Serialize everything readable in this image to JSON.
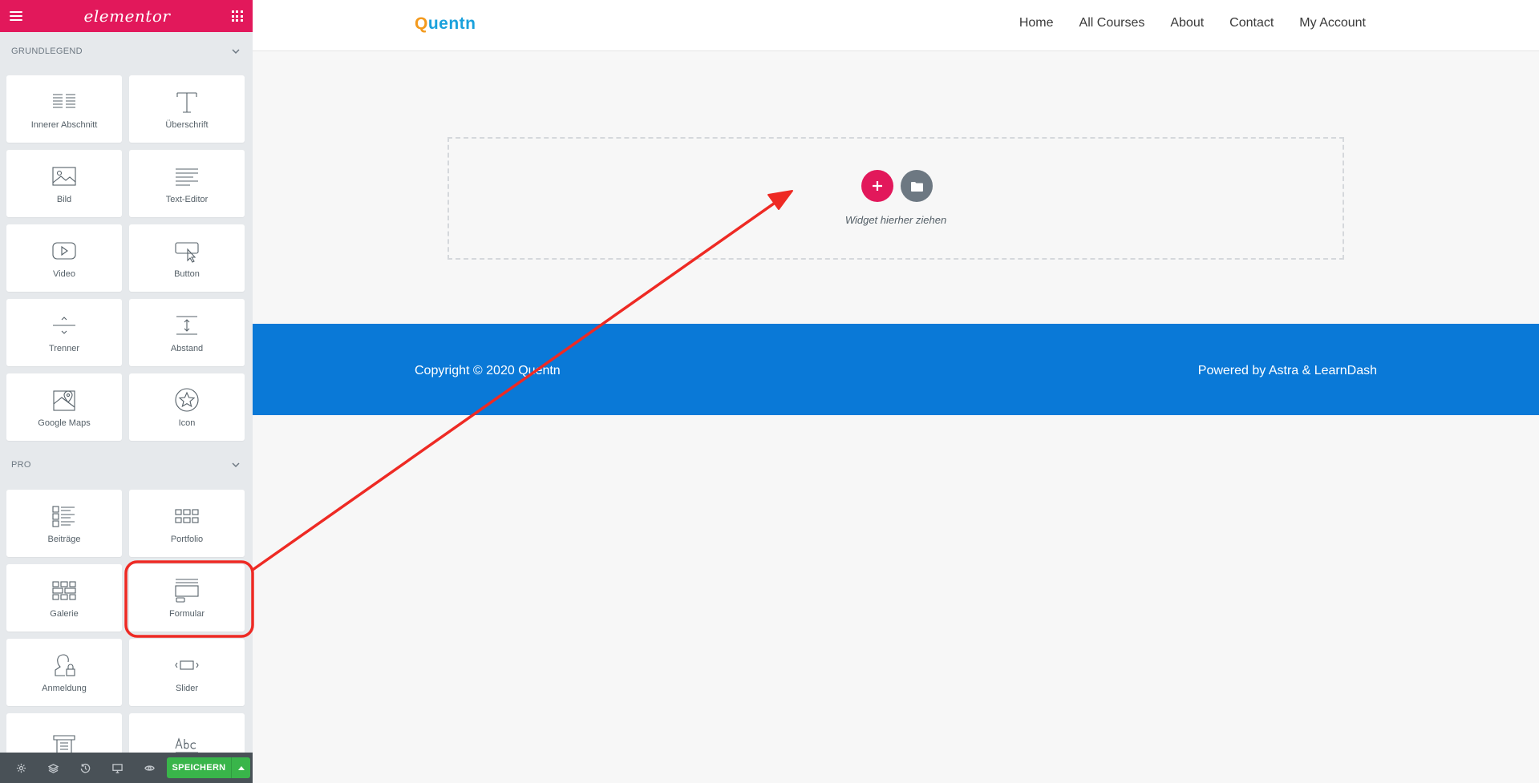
{
  "panel": {
    "brand": "elementor",
    "sections": [
      {
        "title": "GRUNDLEGEND",
        "widgets": [
          {
            "label": "Innerer Abschnitt",
            "icon": "inner-section-icon"
          },
          {
            "label": "Überschrift",
            "icon": "heading-icon"
          },
          {
            "label": "Bild",
            "icon": "image-icon"
          },
          {
            "label": "Text-Editor",
            "icon": "text-editor-icon"
          },
          {
            "label": "Video",
            "icon": "video-icon"
          },
          {
            "label": "Button",
            "icon": "button-icon"
          },
          {
            "label": "Trenner",
            "icon": "divider-icon"
          },
          {
            "label": "Abstand",
            "icon": "spacer-icon"
          },
          {
            "label": "Google Maps",
            "icon": "google-maps-icon"
          },
          {
            "label": "Icon",
            "icon": "star-icon"
          }
        ]
      },
      {
        "title": "PRO",
        "widgets": [
          {
            "label": "Beiträge",
            "icon": "posts-icon"
          },
          {
            "label": "Portfolio",
            "icon": "portfolio-icon"
          },
          {
            "label": "Galerie",
            "icon": "gallery-icon"
          },
          {
            "label": "Formular",
            "icon": "form-icon"
          },
          {
            "label": "Anmeldung",
            "icon": "login-icon"
          },
          {
            "label": "Slider",
            "icon": "slider-icon"
          },
          {
            "label": "",
            "icon": "price-table-icon"
          },
          {
            "label": "",
            "icon": "animated-headline-icon"
          }
        ]
      }
    ],
    "footer": {
      "save_label": "SPEICHERN"
    }
  },
  "site": {
    "logo": "uentn",
    "logo_mark": "Q",
    "nav": [
      "Home",
      "All Courses",
      "About",
      "Contact",
      "My Account"
    ],
    "dropzone_text": "Widget hierher ziehen",
    "footer_left": "Copyright © 2020 Quentn",
    "footer_right": "Powered by Astra & LearnDash"
  },
  "colors": {
    "elementor_pink": "#e2185b",
    "footer_blue": "#0a79d7",
    "save_green": "#39b54a",
    "annotation_red": "#ee2a24"
  }
}
